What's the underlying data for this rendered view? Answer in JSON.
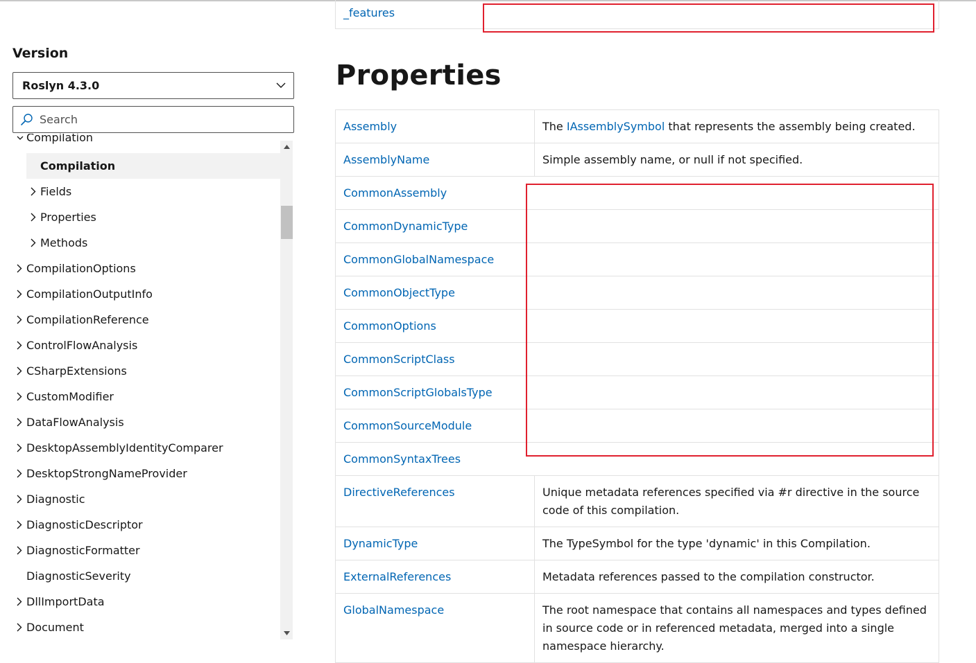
{
  "sidebar": {
    "version_label": "Version",
    "version_value": "Roslyn 4.3.0",
    "search_placeholder": "Search",
    "cut_item": "Compilation",
    "toc": [
      {
        "label": "Compilation",
        "selected": true,
        "expandable": false,
        "indent": 1
      },
      {
        "label": "Fields",
        "selected": false,
        "expandable": true,
        "indent": 1
      },
      {
        "label": "Properties",
        "selected": false,
        "expandable": true,
        "indent": 1
      },
      {
        "label": "Methods",
        "selected": false,
        "expandable": true,
        "indent": 1
      },
      {
        "label": "CompilationOptions",
        "selected": false,
        "expandable": true,
        "indent": 0
      },
      {
        "label": "CompilationOutputInfo",
        "selected": false,
        "expandable": true,
        "indent": 0
      },
      {
        "label": "CompilationReference",
        "selected": false,
        "expandable": true,
        "indent": 0
      },
      {
        "label": "ControlFlowAnalysis",
        "selected": false,
        "expandable": true,
        "indent": 0
      },
      {
        "label": "CSharpExtensions",
        "selected": false,
        "expandable": true,
        "indent": 0
      },
      {
        "label": "CustomModifier",
        "selected": false,
        "expandable": true,
        "indent": 0
      },
      {
        "label": "DataFlowAnalysis",
        "selected": false,
        "expandable": true,
        "indent": 0
      },
      {
        "label": "DesktopAssemblyIdentityComparer",
        "selected": false,
        "expandable": true,
        "indent": 0
      },
      {
        "label": "DesktopStrongNameProvider",
        "selected": false,
        "expandable": true,
        "indent": 0
      },
      {
        "label": "Diagnostic",
        "selected": false,
        "expandable": true,
        "indent": 0
      },
      {
        "label": "DiagnosticDescriptor",
        "selected": false,
        "expandable": true,
        "indent": 0
      },
      {
        "label": "DiagnosticFormatter",
        "selected": false,
        "expandable": true,
        "indent": 0
      },
      {
        "label": "DiagnosticSeverity",
        "selected": false,
        "expandable": false,
        "indent": 0
      },
      {
        "label": "DllImportData",
        "selected": false,
        "expandable": true,
        "indent": 0
      },
      {
        "label": "Document",
        "selected": false,
        "expandable": true,
        "indent": 0
      }
    ]
  },
  "main": {
    "prev_field": "_features",
    "heading": "Properties",
    "properties": [
      {
        "name": "Assembly",
        "desc_pre": "The ",
        "desc_link": "IAssemblySymbol",
        "desc_post": " that represents the assembly being created."
      },
      {
        "name": "AssemblyName",
        "desc_pre": "Simple assembly name, or null if not specified.",
        "desc_link": "",
        "desc_post": ""
      },
      {
        "name": "CommonAssembly",
        "desc_pre": "",
        "desc_link": "",
        "desc_post": ""
      },
      {
        "name": "CommonDynamicType",
        "desc_pre": "",
        "desc_link": "",
        "desc_post": ""
      },
      {
        "name": "CommonGlobalNamespace",
        "desc_pre": "",
        "desc_link": "",
        "desc_post": ""
      },
      {
        "name": "CommonObjectType",
        "desc_pre": "",
        "desc_link": "",
        "desc_post": ""
      },
      {
        "name": "CommonOptions",
        "desc_pre": "",
        "desc_link": "",
        "desc_post": ""
      },
      {
        "name": "CommonScriptClass",
        "desc_pre": "",
        "desc_link": "",
        "desc_post": ""
      },
      {
        "name": "CommonScriptGlobalsType",
        "desc_pre": "",
        "desc_link": "",
        "desc_post": ""
      },
      {
        "name": "CommonSourceModule",
        "desc_pre": "",
        "desc_link": "",
        "desc_post": ""
      },
      {
        "name": "CommonSyntaxTrees",
        "desc_pre": "",
        "desc_link": "",
        "desc_post": ""
      },
      {
        "name": "DirectiveReferences",
        "desc_pre": "Unique metadata references specified via #r directive in the source code of this compilation.",
        "desc_link": "",
        "desc_post": ""
      },
      {
        "name": "DynamicType",
        "desc_pre": "The TypeSymbol for the type 'dynamic' in this Compilation.",
        "desc_link": "",
        "desc_post": ""
      },
      {
        "name": "ExternalReferences",
        "desc_pre": "Metadata references passed to the compilation constructor.",
        "desc_link": "",
        "desc_post": ""
      },
      {
        "name": "GlobalNamespace",
        "desc_pre": "The root namespace that contains all namespaces and types defined in source code or in referenced metadata, merged into a single namespace hierarchy.",
        "desc_link": "",
        "desc_post": ""
      }
    ]
  },
  "colors": {
    "link": "#0065b3",
    "annotation_box": "#e0202e",
    "selected_bg": "#f2f2f2"
  }
}
